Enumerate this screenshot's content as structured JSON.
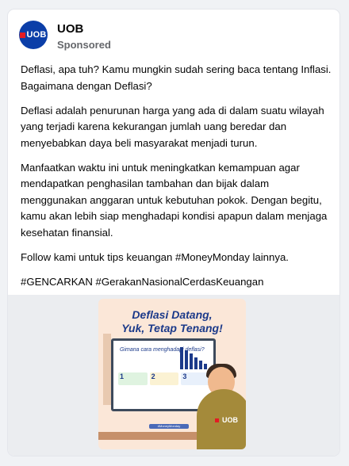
{
  "post": {
    "advertiser": "UOB",
    "avatar_text": "UOB",
    "label": "Sponsored",
    "paragraphs": [
      "Deflasi, apa tuh? Kamu mungkin sudah sering baca tentang Inflasi. Bagaimana dengan Deflasi?",
      "Deflasi adalah penurunan harga yang ada di dalam suatu wilayah yang terjadi karena kekurangan jumlah uang beredar dan menyebabkan daya beli masyarakat menjadi turun.",
      "Manfaatkan waktu ini untuk meningkatkan kemampuan agar mendapatkan penghasilan tambahan dan bijak dalam menggunakan anggaran untuk kebutuhan pokok. Dengan begitu, kamu akan lebih siap menghadapi kondisi apapun dalam menjaga kesehatan finansial.",
      "Follow kami untuk tips keuangan #MoneyMonday lainnya.",
      "#GENCARKAN #GerakanNasionalCerdasKeuangan"
    ]
  },
  "ad_image": {
    "title_line1": "Deflasi Datang,",
    "title_line2": "Yuk, Tetap Tenang!",
    "question": "Gimana cara menghadapi deflasi?",
    "steps": [
      "1",
      "2",
      "3"
    ],
    "tag": "#MoneyMonday",
    "logo": "UOB",
    "bar_levels": [
      1.0,
      0.85,
      0.7,
      0.55,
      0.4,
      0.25
    ]
  },
  "colors": {
    "brand_blue": "#0b3ea8",
    "brand_red": "#e31b23",
    "ad_background": "#fbe7d8"
  }
}
